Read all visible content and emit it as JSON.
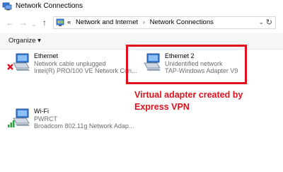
{
  "window": {
    "title": "Network Connections"
  },
  "address_bar": {
    "overflow": "«",
    "crumbs": [
      "Network and Internet",
      "Network Connections"
    ],
    "separator": "›"
  },
  "toolbar": {
    "organize_label": "Organize ▾"
  },
  "connections": [
    {
      "name": "Ethernet",
      "status": "Network cable unplugged",
      "adapter": "Intel(R) PRO/100 VE Network Con...",
      "icon": "ethernet-disconnected-icon"
    },
    {
      "name": "Ethernet 2",
      "status": "Unidentified network",
      "adapter": "TAP-Windows Adapter V9",
      "icon": "ethernet-icon"
    },
    {
      "name": "Wi-Fi",
      "status": "PWRCT",
      "adapter": "Broadcom 802.11g Network Adap...",
      "icon": "wifi-icon"
    }
  ],
  "annotation": {
    "text": "Virtual adapter created by Express VPN",
    "color": "#e0101c"
  }
}
